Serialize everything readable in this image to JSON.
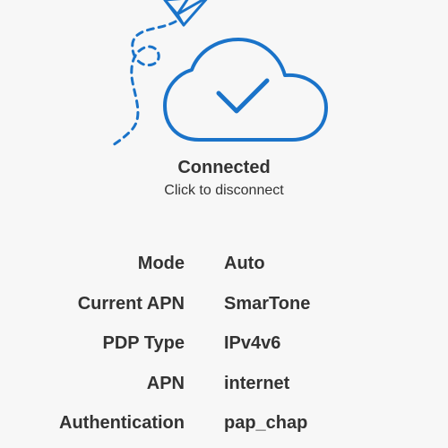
{
  "status": {
    "title": "Connected",
    "subtitle": "Click to disconnect"
  },
  "info": {
    "rows": [
      {
        "label": "Mode",
        "value": "Auto"
      },
      {
        "label": "Current APN",
        "value": "SmarTone"
      },
      {
        "label": "PDP Type",
        "value": "IPv4v6"
      },
      {
        "label": "APN",
        "value": "internet"
      },
      {
        "label": "Authentication",
        "value": "pap_chap"
      }
    ]
  },
  "icons": {
    "hero": "cloud-check-icon",
    "decoration": "paper-plane-icon"
  },
  "colors": {
    "accent": "#1a73c9",
    "background": "#f7f7f7",
    "text": "#333333"
  }
}
